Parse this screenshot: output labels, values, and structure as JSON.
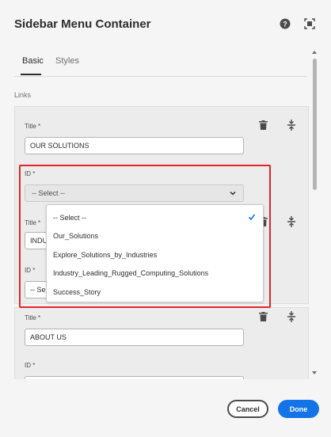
{
  "header": {
    "title": "Sidebar Menu Container",
    "help_icon": "help-icon",
    "fullscreen_icon": "fullscreen-icon"
  },
  "tabs": [
    {
      "label": "Basic",
      "active": true
    },
    {
      "label": "Styles",
      "active": false
    }
  ],
  "section": {
    "label": "Links"
  },
  "items": [
    {
      "title_label": "Title *",
      "title_value": "OUR SOLUTIONS",
      "id_label": "ID *",
      "id_value": "-- Select --"
    },
    {
      "title_label": "Title *",
      "title_value": "INDU",
      "id_label": "ID *",
      "id_value": "-- Se"
    },
    {
      "title_label": "Title *",
      "title_value": "ABOUT US",
      "id_label": "ID *"
    }
  ],
  "dropdown": {
    "options": [
      {
        "label": "-- Select --",
        "selected": true
      },
      {
        "label": "Our_Solutions"
      },
      {
        "label": "Explore_Solutions_by_Industries"
      },
      {
        "label": "Industry_Leading_Rugged_Computing_Solutions"
      },
      {
        "label": "Success_Story"
      }
    ]
  },
  "footer": {
    "cancel_label": "Cancel",
    "done_label": "Done"
  },
  "colors": {
    "accent": "#1473e6",
    "highlight": "#e0262a"
  }
}
